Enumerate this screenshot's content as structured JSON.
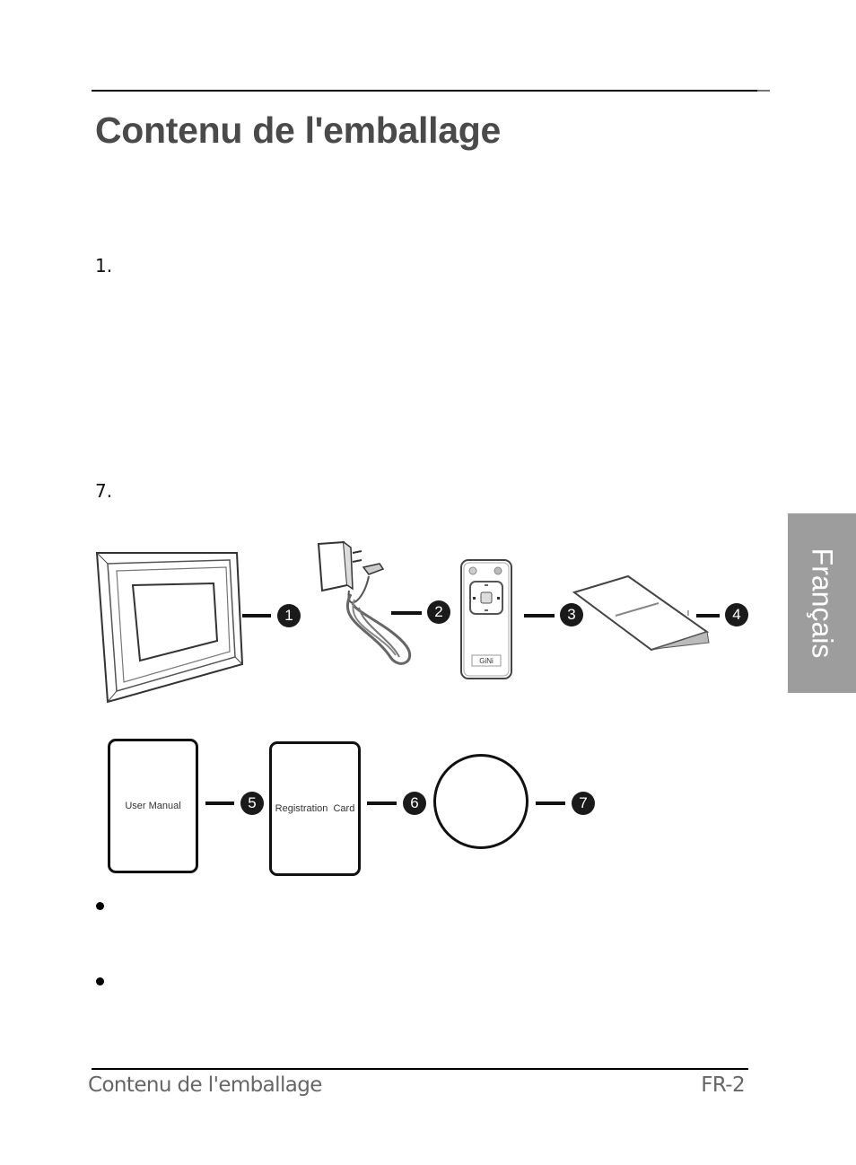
{
  "header": {
    "title": "Contenu de l'emballage"
  },
  "list": {
    "first_number": "1.",
    "last_number": "7."
  },
  "side_tab": {
    "label": "Français",
    "color": "#9d9d9d"
  },
  "figure": {
    "items": [
      {
        "number": "1",
        "icon": "digital-photo-frame-icon"
      },
      {
        "number": "2",
        "icon": "ac-power-adapter-icon"
      },
      {
        "number": "3",
        "icon": "remote-control-icon",
        "brand_text": "GiNi"
      },
      {
        "number": "4",
        "icon": "quick-start-guide-icon"
      },
      {
        "number": "5",
        "icon": "user-manual-card",
        "label": "User Manual"
      },
      {
        "number": "6",
        "icon": "registration-card",
        "label": "Registration  Card"
      },
      {
        "number": "7",
        "icon": "disc-icon"
      }
    ]
  },
  "bullets": [
    {
      "text": ""
    },
    {
      "text": ""
    }
  ],
  "footer": {
    "section": "Contenu de l'emballage",
    "page": "FR-2"
  }
}
